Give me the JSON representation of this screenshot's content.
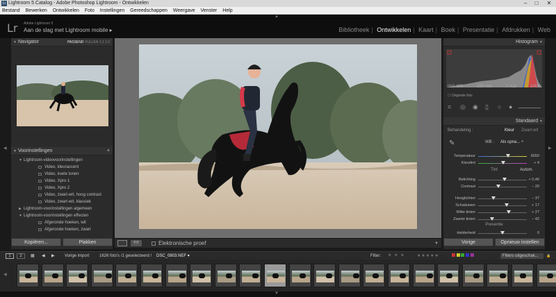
{
  "window": {
    "title": "Lightroom 5 Catalog - Adobe Photoshop Lightroom - Ontwikkelen",
    "controls": [
      "minimize",
      "maximize",
      "close"
    ]
  },
  "menu": [
    "Bestand",
    "Bewerken",
    "Ontwikkelen",
    "Foto",
    "Instellingen",
    "Gereedschappen",
    "Weergave",
    "Venster",
    "Help"
  ],
  "identity": {
    "logo": "Lr",
    "product": "Adobe Lightroom 5",
    "headline": "Aan de slag met Lightroom mobile"
  },
  "modules": [
    "Bibliotheek",
    "Ontwikkelen",
    "Kaart",
    "Boek",
    "Presentatie",
    "Afdrukken",
    "Web"
  ],
  "active_module": "Ontwikkelen",
  "navigator": {
    "title": "Navigator",
    "zoom_options": [
      "PASSEND",
      "VULLEN",
      "1:1",
      "1:2"
    ],
    "selected_zoom": "PASSEND"
  },
  "presets": {
    "title": "Voorinstellingen",
    "add": "+",
    "items": [
      {
        "label": "Lightroom-videovoorinstellingen",
        "kind": "folder",
        "open": true
      },
      {
        "label": "Video, kleuraccent",
        "kind": "preset"
      },
      {
        "label": "Video, koele tonen",
        "kind": "preset"
      },
      {
        "label": "Video, Xpro 1",
        "kind": "preset"
      },
      {
        "label": "Video, Xpro 2",
        "kind": "preset"
      },
      {
        "label": "Video, zwart-wit, hoog contrast",
        "kind": "preset"
      },
      {
        "label": "Video, zwart-wit, klassiek",
        "kind": "preset"
      },
      {
        "label": "Lightroom-voorinstellingen algemeen",
        "kind": "folder",
        "open": false
      },
      {
        "label": "Lightroom-voorinstellingen effecten",
        "kind": "folder",
        "open": true
      },
      {
        "label": "Afgeronde hoeken, wit",
        "kind": "preset"
      },
      {
        "label": "Afgeronde hoeken, zwart",
        "kind": "preset"
      }
    ]
  },
  "left_buttons": {
    "copy": "Kopiëren...",
    "paste": "Plakken"
  },
  "toolbar": {
    "view_label": "Y|Y",
    "softproof": "Elektronische proef"
  },
  "histogram": {
    "title": "Histogram",
    "exif": [
      "ISO 400",
      "155 mm",
      "f / 4,8",
      "1/500"
    ],
    "original_photo": "Originele foto"
  },
  "basic": {
    "title": "Standaard",
    "treatment_label": "Behandeling :",
    "treatment_color": "Kleur",
    "treatment_bw": "Zwart-wit",
    "wb_label": "WB :",
    "wb_value": "Als opna... ÷",
    "tone_label": "Tint",
    "tone_auto": "Autom.",
    "presence_label": "Presentie",
    "sliders": [
      {
        "label": "Temperatuur",
        "value": "6650",
        "pos": 0.62
      },
      {
        "label": "Kleurtint",
        "value": "+ 4",
        "pos": 0.52
      },
      {
        "label": "Belichting",
        "value": "+ 0,40",
        "pos": 0.54
      },
      {
        "label": "Contrast",
        "value": "− 20",
        "pos": 0.42
      },
      {
        "label": "Hooglichten",
        "value": "− 37",
        "pos": 0.32
      },
      {
        "label": "Schaduwen",
        "value": "+ 17",
        "pos": 0.58
      },
      {
        "label": "Witte tinten",
        "value": "+ 27",
        "pos": 0.63
      },
      {
        "label": "Zwarte tinten",
        "value": "− 42",
        "pos": 0.29
      },
      {
        "label": "Helderheid",
        "value": "0",
        "pos": 0.5
      }
    ]
  },
  "right_buttons": {
    "previous": "Vorige",
    "reset": "Opnieuw instellen"
  },
  "filmstrip_bar": {
    "page1": "1",
    "page2": "2",
    "source_label": "Vorige import",
    "count_text": "1626 foto's /1 geselecteerd /",
    "filename": "DSC_0803.NEF",
    "filter_label": "Filter:",
    "filter_value": "Filters uitgeschak..."
  },
  "colors": {
    "accent_active": "#eeeeee",
    "panel_bg": "#2b2b2b",
    "app_bg": "#1a1a1a"
  }
}
